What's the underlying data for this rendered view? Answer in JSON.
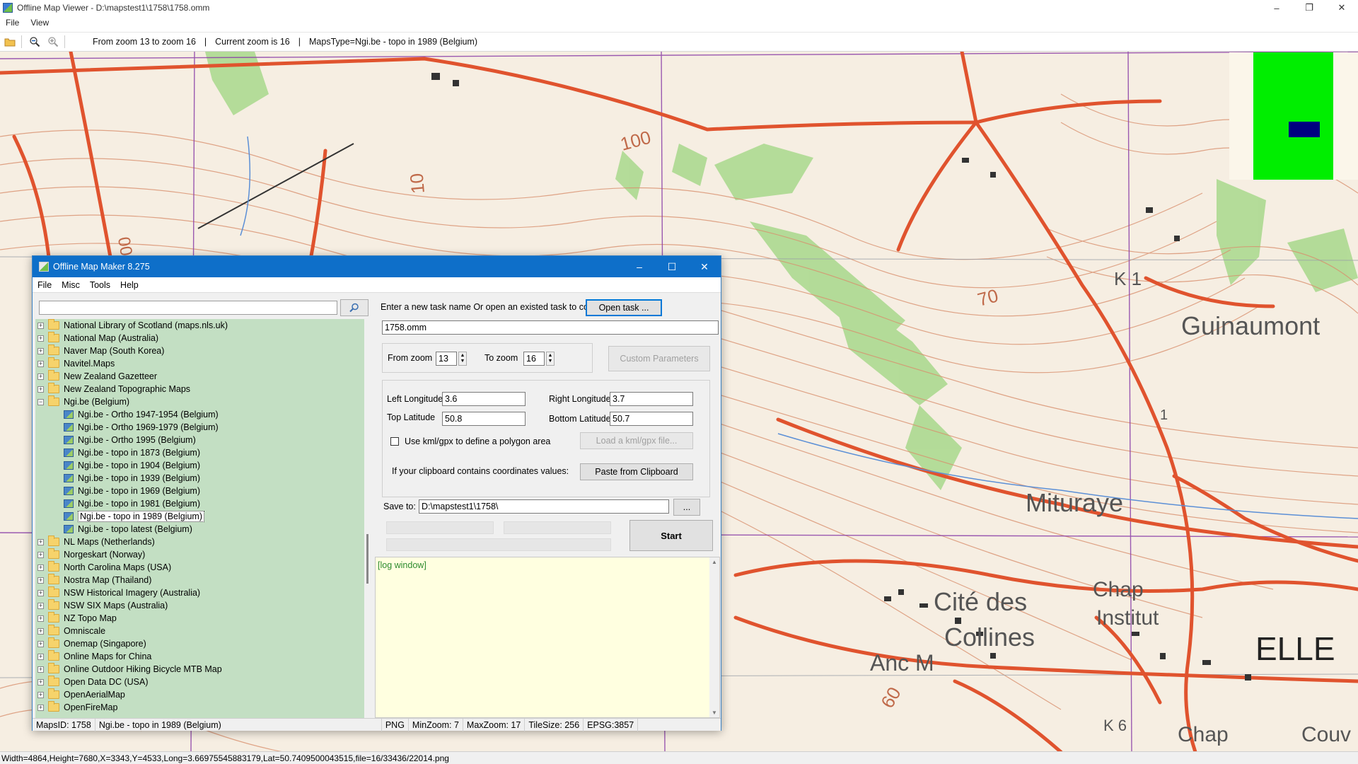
{
  "viewer": {
    "title": "Offline Map Viewer - D:\\mapstest1\\1758\\1758.omm",
    "menu": [
      "File",
      "View"
    ],
    "window_controls": [
      "–",
      "❐",
      "✕"
    ],
    "toolbar_info": {
      "zoom_range": "From zoom 13 to zoom 16",
      "sep1": "|",
      "current_zoom": "Current zoom is 16",
      "sep2": "|",
      "maps_type": "MapsType=Ngi.be - topo in 1989 (Belgium)"
    },
    "status": "Width=4864,Height=7680,X=3343,Y=4533,Long=3.66975545883179,Lat=50.7409500043515,file=16/33436/22014.png",
    "map_labels": [
      "Guinaumont",
      "Mituraye",
      "Cité des",
      "Collines",
      "Chap",
      "Institut",
      "Anc M",
      "ELLE",
      "Chap",
      "Couv",
      "K 1",
      "K 6",
      "100",
      "100",
      "70",
      "60",
      "10",
      "1"
    ]
  },
  "dialog": {
    "title": "Offline Map Maker 8.275",
    "window_controls": [
      "–",
      "☐",
      "✕"
    ],
    "menu": [
      "File",
      "Misc",
      "Tools",
      "Help"
    ],
    "search": {
      "value": ""
    },
    "tree": [
      {
        "label": "National Library of Scotland (maps.nls.uk)",
        "type": "folder",
        "expander": "+"
      },
      {
        "label": "National Map (Australia)",
        "type": "folder",
        "expander": "+"
      },
      {
        "label": "Naver Map (South Korea)",
        "type": "folder",
        "expander": "+"
      },
      {
        "label": "Navitel.Maps",
        "type": "folder",
        "expander": "+"
      },
      {
        "label": "New Zealand Gazetteer",
        "type": "folder",
        "expander": "+"
      },
      {
        "label": "New Zealand Topographic Maps",
        "type": "folder",
        "expander": "+"
      },
      {
        "label": "Ngi.be (Belgium)",
        "type": "folder-open",
        "expander": "−"
      },
      {
        "label": "Ngi.be - Ortho 1947-1954 (Belgium)",
        "type": "map"
      },
      {
        "label": "Ngi.be - Ortho 1969-1979 (Belgium)",
        "type": "map"
      },
      {
        "label": "Ngi.be - Ortho 1995 (Belgium)",
        "type": "map"
      },
      {
        "label": "Ngi.be - topo in 1873 (Belgium)",
        "type": "map"
      },
      {
        "label": "Ngi.be - topo in 1904 (Belgium)",
        "type": "map"
      },
      {
        "label": "Ngi.be - topo in 1939 (Belgium)",
        "type": "map"
      },
      {
        "label": "Ngi.be - topo in 1969 (Belgium)",
        "type": "map"
      },
      {
        "label": "Ngi.be - topo in 1981 (Belgium)",
        "type": "map"
      },
      {
        "label": "Ngi.be - topo in 1989 (Belgium)",
        "type": "map",
        "selected": true
      },
      {
        "label": "Ngi.be - topo latest (Belgium)",
        "type": "map"
      },
      {
        "label": "NL Maps (Netherlands)",
        "type": "folder",
        "expander": "+"
      },
      {
        "label": "Norgeskart (Norway)",
        "type": "folder",
        "expander": "+"
      },
      {
        "label": "North Carolina Maps (USA)",
        "type": "folder",
        "expander": "+"
      },
      {
        "label": "Nostra Map (Thailand)",
        "type": "folder",
        "expander": "+"
      },
      {
        "label": "NSW Historical Imagery (Australia)",
        "type": "folder",
        "expander": "+"
      },
      {
        "label": "NSW SIX Maps (Australia)",
        "type": "folder",
        "expander": "+"
      },
      {
        "label": "NZ Topo Map",
        "type": "folder",
        "expander": "+"
      },
      {
        "label": "Omniscale",
        "type": "folder",
        "expander": "+"
      },
      {
        "label": "Onemap (Singapore)",
        "type": "folder",
        "expander": "+"
      },
      {
        "label": "Online Maps for China",
        "type": "folder",
        "expander": "+"
      },
      {
        "label": "Online Outdoor Hiking Bicycle MTB Map",
        "type": "folder",
        "expander": "+"
      },
      {
        "label": "Open Data DC (USA)",
        "type": "folder",
        "expander": "+"
      },
      {
        "label": "OpenAerialMap",
        "type": "folder",
        "expander": "+"
      },
      {
        "label": "OpenFireMap",
        "type": "folder",
        "expander": "+"
      }
    ],
    "task": {
      "prompt": "Enter a new task name Or open an existed task to continue:",
      "open_button": "Open task ...",
      "name_value": "1758.omm"
    },
    "zoom": {
      "from_label": "From zoom",
      "from_value": "13",
      "to_label": "To zoom",
      "to_value": "16",
      "custom_button": "Custom Parameters"
    },
    "area": {
      "left_lon_label": "Left Longitude",
      "left_lon_value": "3.6",
      "right_lon_label": "Right Longitude",
      "right_lon_value": "3.7",
      "top_lat_label": "Top Latitude",
      "top_lat_value": "50.8",
      "bottom_lat_label": "Bottom Latitude",
      "bottom_lat_value": "50.7",
      "kml_checkbox_label": "Use kml/gpx to define a polygon area",
      "kml_checked": false,
      "load_kml_button": "Load a kml/gpx file...",
      "clipboard_label": "If your clipboard contains coordinates values:",
      "paste_button": "Paste from Clipboard"
    },
    "save": {
      "label": "Save to:",
      "path_value": "D:\\mapstest1\\1758\\",
      "browse_button": "...",
      "start_button": "Start"
    },
    "log": {
      "label": "[log window]"
    },
    "statusbar": {
      "maps_id": "MapsID: 1758",
      "maps_name": "Ngi.be - topo in 1989 (Belgium)",
      "format": "PNG",
      "min_zoom": "MinZoom: 7",
      "max_zoom": "MaxZoom: 17",
      "tile_size": "TileSize: 256",
      "epsg": "EPSG:3857"
    }
  },
  "colors": {
    "title_blue": "#0e6fc9",
    "tree_bg": "#c3dfc3",
    "log_bg": "#ffffe0",
    "minimap_green": "#00ee00",
    "minimap_blue": "#000080",
    "road_red": "#e0532e",
    "contour": "#d98a6a"
  }
}
